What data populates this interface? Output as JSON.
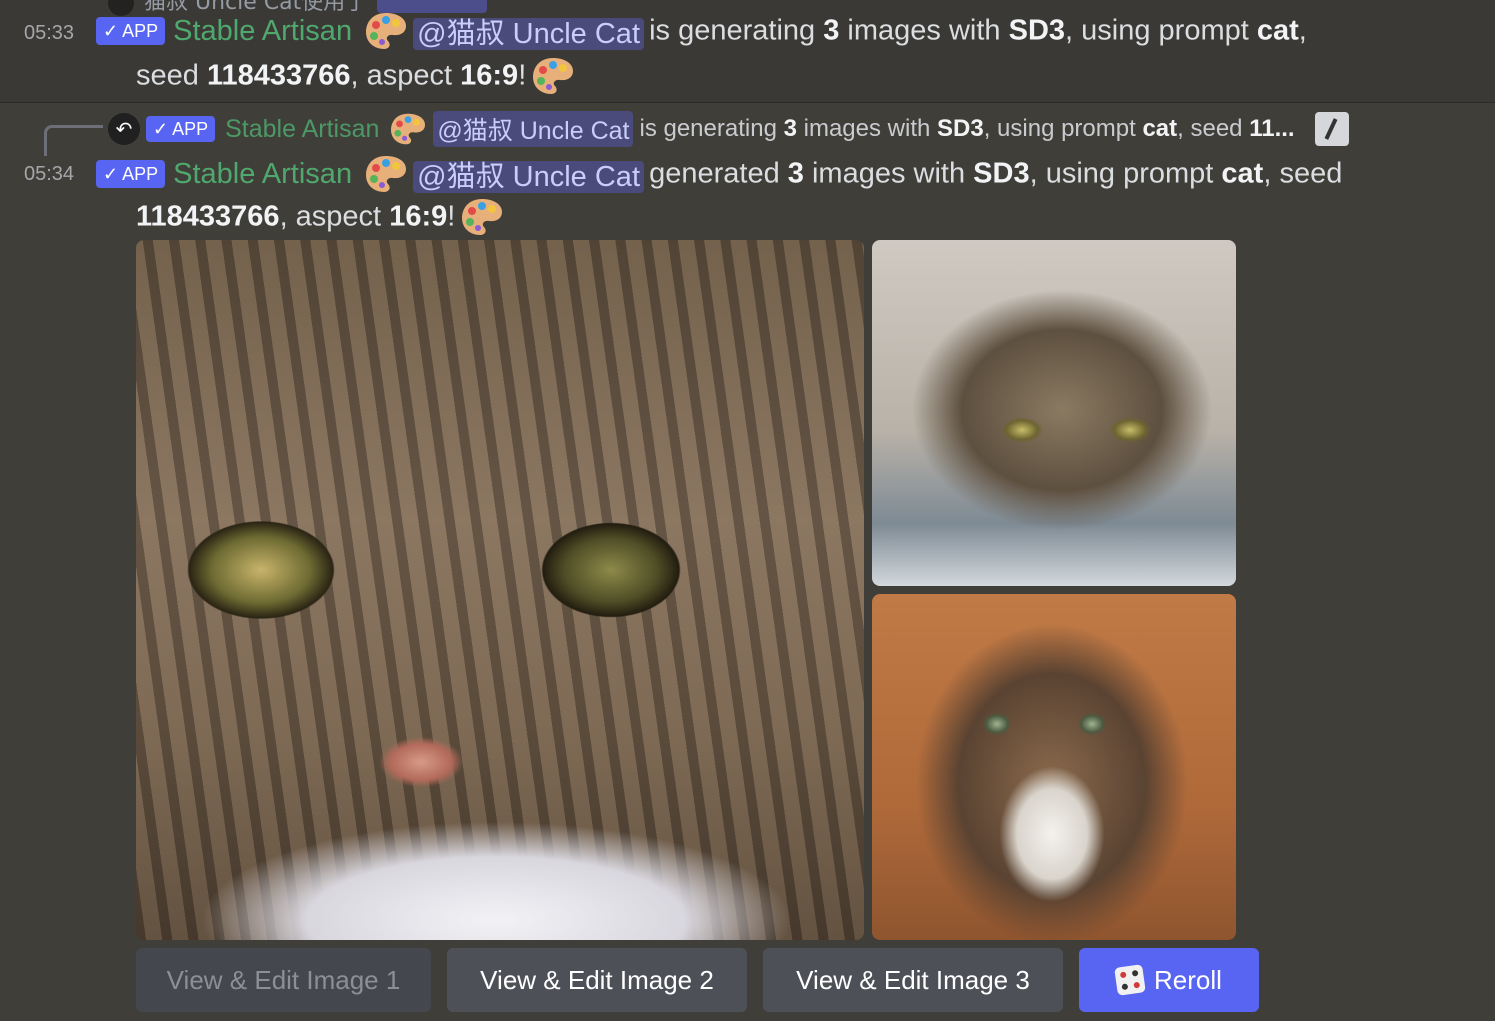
{
  "message1": {
    "cut_text": "猫叔 Uncle Cat使用了",
    "time": "05:33",
    "badge": "APP",
    "author": "Stable Artisan",
    "mention": "@猫叔 Uncle Cat",
    "t1": "is generating",
    "count": "3",
    "t2": "images with",
    "model": "SD3",
    "t3": ", using prompt",
    "prompt": "cat",
    "t4": ",",
    "t5": "seed",
    "seed": "118433766",
    "t6": ", aspect",
    "aspect": "16:9",
    "t7": "!"
  },
  "reply": {
    "badge": "APP",
    "author": "Stable Artisan",
    "mention": "@猫叔 Uncle Cat",
    "t1": "is generating",
    "count": "3",
    "t2": "images with",
    "model": "SD3",
    "t3": ", using prompt",
    "prompt": "cat",
    "t4": ", seed",
    "seed_trunc": "11..."
  },
  "message2": {
    "time": "05:34",
    "badge": "APP",
    "author": "Stable Artisan",
    "mention": "@猫叔 Uncle Cat",
    "t1": "generated",
    "count": "3",
    "t2": "images with",
    "model": "SD3",
    "t3": ", using prompt",
    "prompt": "cat",
    "t4": ", seed",
    "seed": "118433766",
    "t5": ", aspect",
    "aspect": "16:9",
    "t6": "!"
  },
  "images": [
    "cat close-up",
    "tabby cat lying",
    "fluffy tabby cat looking up"
  ],
  "buttons": {
    "b1": "View & Edit Image 1",
    "b2": "View & Edit Image 2",
    "b3": "View & Edit Image 3",
    "b4": "Reroll"
  },
  "colors": {
    "background": "#3b3935",
    "app_badge": "#5865f2",
    "author": "#4fa86e",
    "mention_bg": "#4a4b7a",
    "reroll": "#5865f2"
  }
}
